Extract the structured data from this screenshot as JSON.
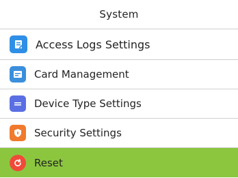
{
  "header": {
    "title": "System"
  },
  "menu": {
    "items": [
      {
        "label": "Access Logs Settings",
        "icon": "access-logs-icon",
        "color": "#2f8fe6"
      },
      {
        "label": "Card Management",
        "icon": "card-icon",
        "color": "#3b8fdc"
      },
      {
        "label": "Device Type Settings",
        "icon": "device-type-icon",
        "color": "#5a6fe3"
      },
      {
        "label": "Security Settings",
        "icon": "security-shield-icon",
        "color": "#f07a2d"
      },
      {
        "label": "Reset",
        "icon": "reset-icon",
        "color": "#f04a3a"
      }
    ],
    "selected_index": 4,
    "selected_color": "#8cc63f"
  }
}
